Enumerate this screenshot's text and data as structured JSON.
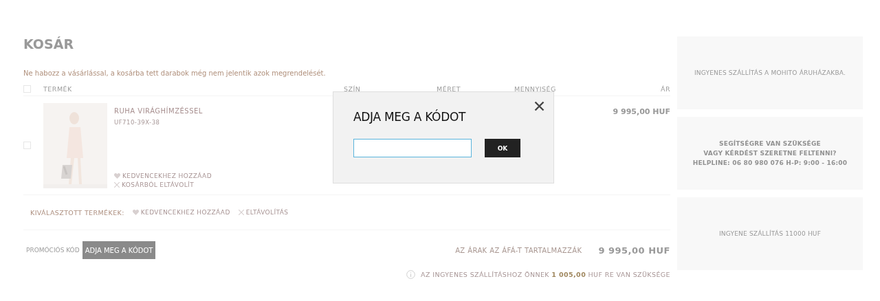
{
  "page_title": "KOSÁR",
  "notice": "Ne habozz a vásárlással, a kosárba tett darabok még nem jelentik azok megrendelését.",
  "table": {
    "select_all": {
      "checked": false
    },
    "columns": [
      "TERMÉK",
      "SZÍN",
      "MÉRET",
      "MENNYISÉG",
      "ÁR"
    ],
    "rows": [
      {
        "checked": false,
        "image": {
          "kind": "picture"
        },
        "name": "RUHA VIRÁGHÍMZÉSSEL",
        "code": "UF710-39X-38",
        "actions": [
          {
            "kind": "favorite",
            "label": "KEDVENCEKHEZ HOZZÁAD"
          },
          {
            "kind": "remove",
            "label": "KOSÁRBÓL ELTÁVOLÍT"
          }
        ],
        "price": "9 995,00 HUF"
      }
    ]
  },
  "selected_actions": {
    "label": "KIVÁLASZTOTT TERMÉKEK:",
    "actions": [
      {
        "kind": "favorite",
        "label": "KEDVENCEKHEZ HOZZÁAD"
      },
      {
        "kind": "remove",
        "label": "ELTÁVOLÍTÁS"
      }
    ]
  },
  "promo": {
    "label": "PROMÓCIÓS KÓD",
    "button": "ADJA MEG A KÓDOT"
  },
  "total": {
    "label": "AZ ÁRAK AZ ÁFÁ-T TARTALMAZZÁK",
    "value": "9 995,00 HUF"
  },
  "shipping_note": "AZ INGYENES SZÁLLÍTÁSHOZ ÖNNEK **1 005,00** HUF RE VAN SZÜKSÉGE",
  "banners": [
    {
      "lines": [
        "INGYENES SZÁLLÍTÁS A MOHITO ÁRUHÁZAKBA."
      ],
      "bold": false
    },
    {
      "lines": [
        "SEGÍTSÉGRE VAN SZÜKSÉGE",
        "VAGY KÉRDÉST SZERETNE FELTENNI?",
        "HELPLINE: 06 80 980 076 H-P: 9:00 - 16:00"
      ],
      "bold": true
    },
    {
      "lines": [
        "INGYENE SZÁLLÍTÁS 11000 HUF"
      ],
      "bold": false
    }
  ],
  "dialog": {
    "title": "ADJA MEG A KÓDOT",
    "button": "OK"
  }
}
